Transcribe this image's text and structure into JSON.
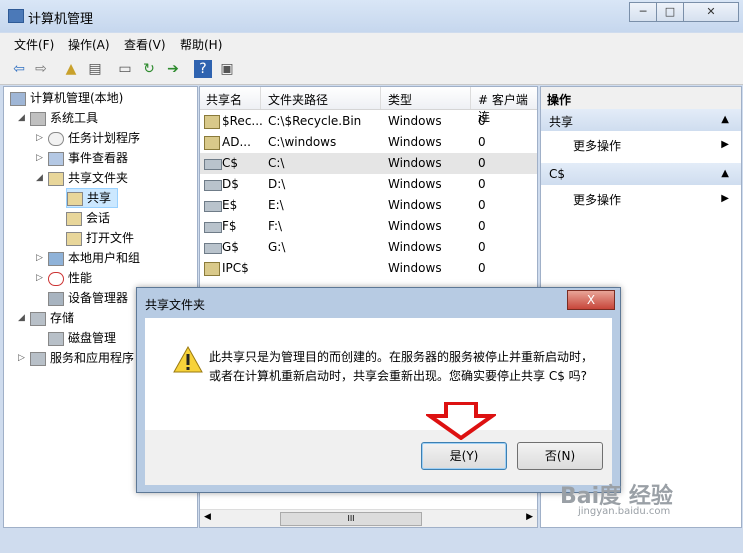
{
  "window": {
    "title": "计算机管理"
  },
  "menu": [
    "文件(F)",
    "操作(A)",
    "查看(V)",
    "帮助(H)"
  ],
  "tree": {
    "root": "计算机管理(本地)",
    "system_tools": "系统工具",
    "task_scheduler": "任务计划程序",
    "event_viewer": "事件查看器",
    "shared_folders": "共享文件夹",
    "shares": "共享",
    "sessions": "会话",
    "open_files": "打开文件",
    "local_users": "本地用户和组",
    "performance": "性能",
    "device_manager": "设备管理器",
    "storage": "存储",
    "disk_management": "磁盘管理",
    "services_apps": "服务和应用程序"
  },
  "list": {
    "headers": [
      "共享名",
      "文件夹路径",
      "类型",
      "# 客户端连"
    ],
    "rows": [
      {
        "name": "$Rec...",
        "path": "C:\\$Recycle.Bin",
        "type": "Windows",
        "count": "0",
        "icon": "share-icon"
      },
      {
        "name": "AD...",
        "path": "C:\\windows",
        "type": "Windows",
        "count": "0",
        "icon": "share-icon"
      },
      {
        "name": "C$",
        "path": "C:\\",
        "type": "Windows",
        "count": "0",
        "icon": "drive-icon"
      },
      {
        "name": "D$",
        "path": "D:\\",
        "type": "Windows",
        "count": "0",
        "icon": "drive-icon"
      },
      {
        "name": "E$",
        "path": "E:\\",
        "type": "Windows",
        "count": "0",
        "icon": "drive-icon"
      },
      {
        "name": "F$",
        "path": "F:\\",
        "type": "Windows",
        "count": "0",
        "icon": "drive-icon"
      },
      {
        "name": "G$",
        "path": "G:\\",
        "type": "Windows",
        "count": "0",
        "icon": "drive-icon"
      },
      {
        "name": "IPC$",
        "path": "",
        "type": "Windows",
        "count": "0",
        "icon": "share-icon"
      }
    ],
    "scroll_thumb": "III"
  },
  "actions": {
    "header": "操作",
    "section1": "共享",
    "more1": "更多操作",
    "section2": "C$",
    "more2": "更多操作"
  },
  "dialog": {
    "title": "共享文件夹",
    "close": "X",
    "message": "此共享只是为管理目的而创建的。在服务器的服务被停止并重新启动时，或者在计算机重新启动时，共享会重新出现。您确实要停止共享 C$ 吗?",
    "yes": "是(Y)",
    "no": "否(N)"
  },
  "watermark": {
    "main": "Bai度 经验",
    "sub": "jingyan.baidu.com"
  }
}
